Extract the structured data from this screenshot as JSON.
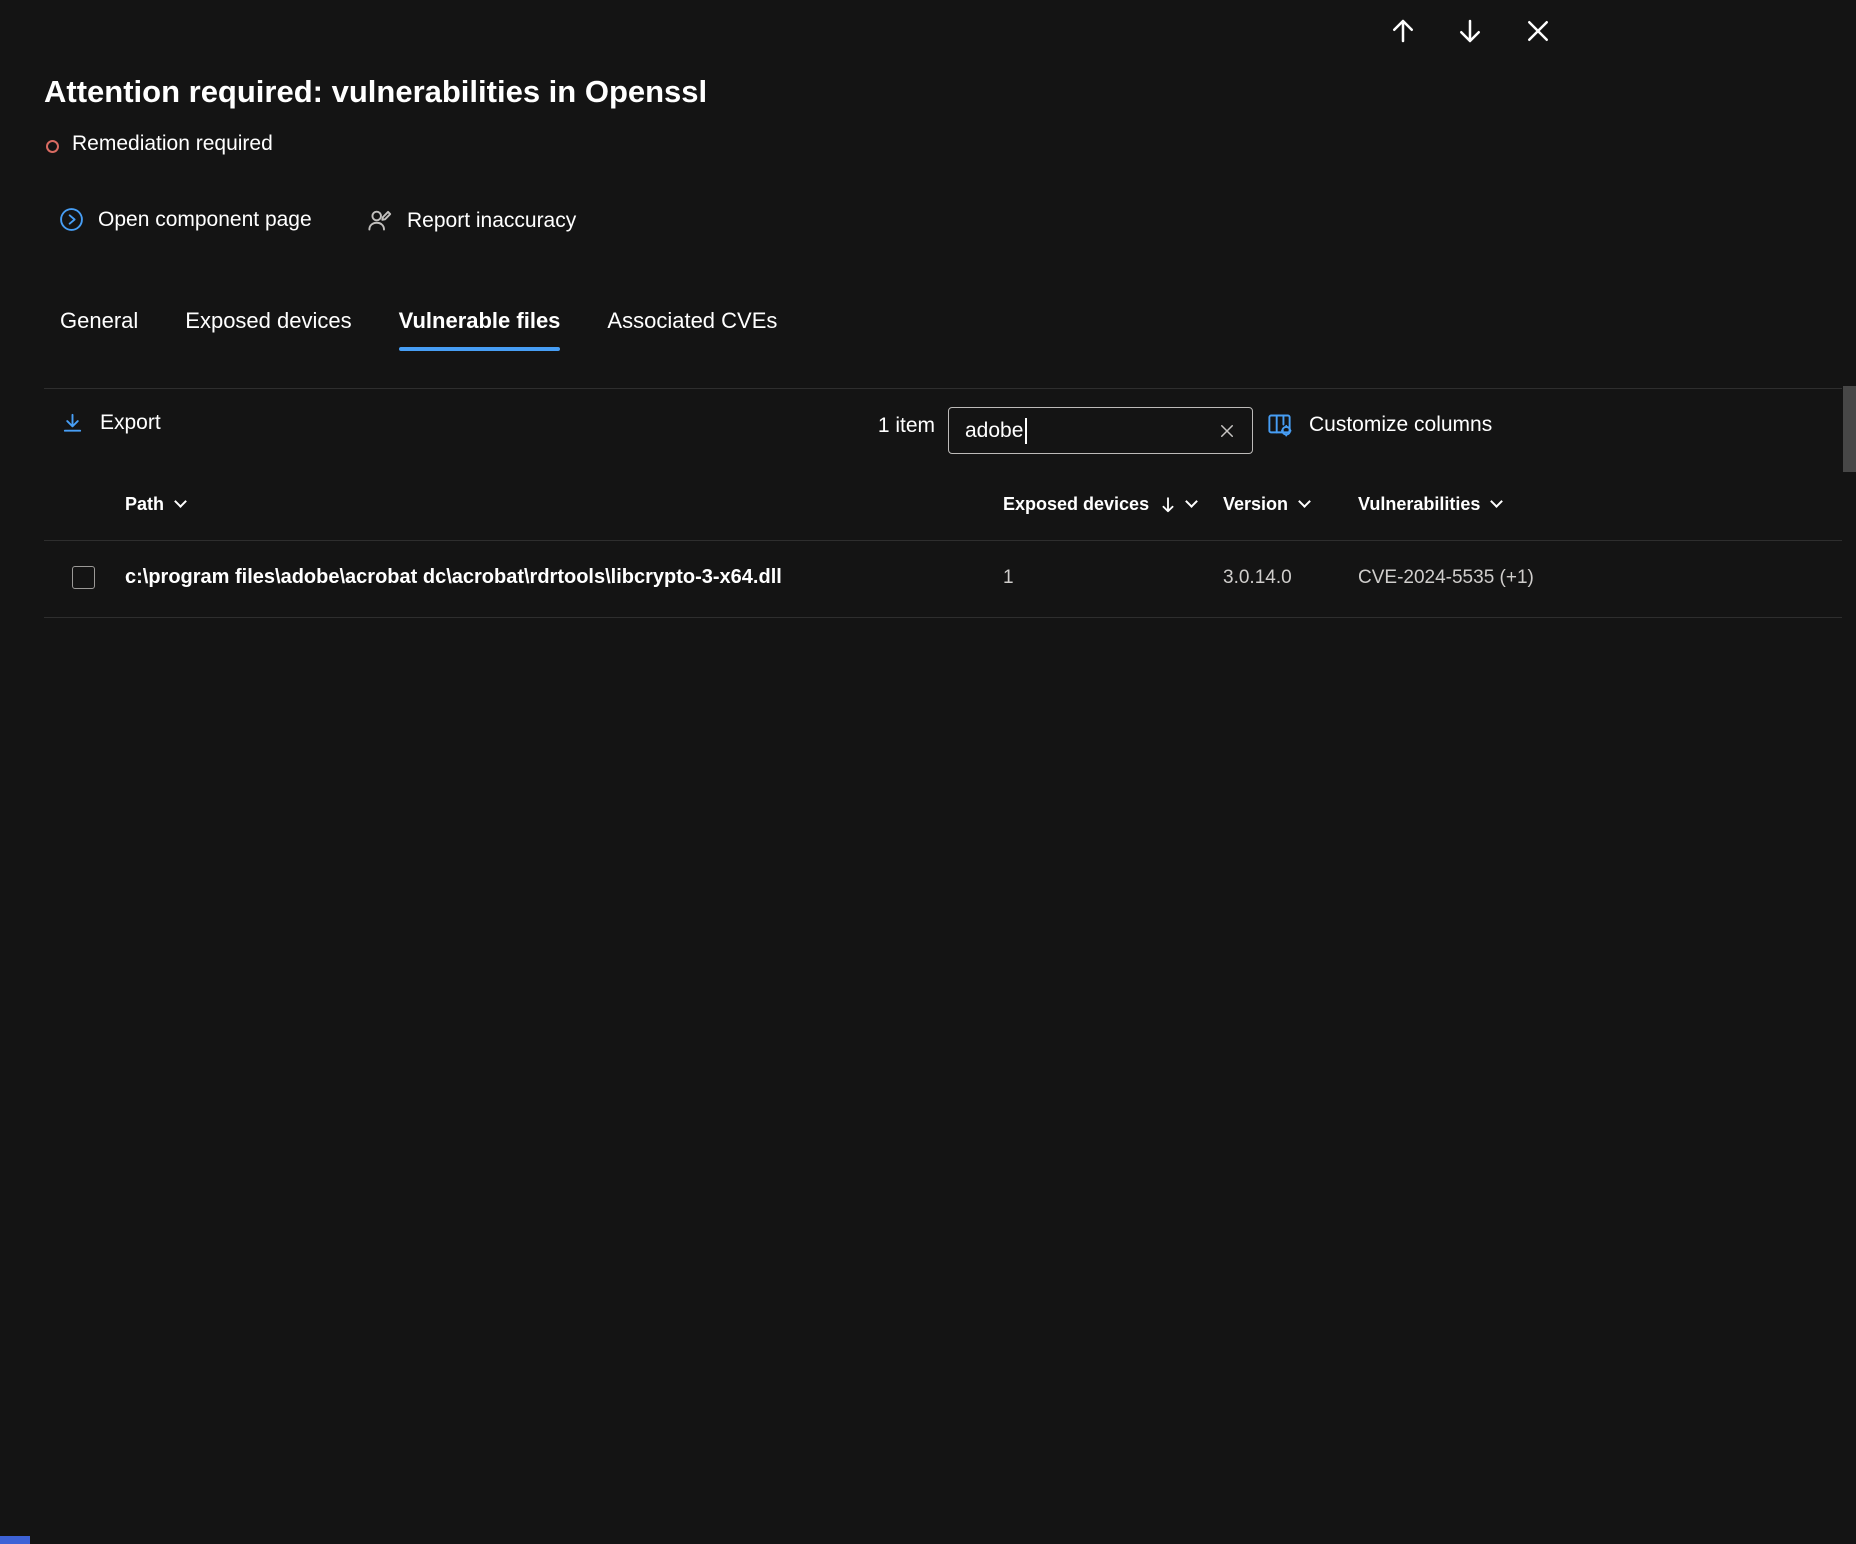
{
  "header": {
    "title": "Attention required: vulnerabilities in Openssl",
    "status": "Remediation required"
  },
  "actions": {
    "open_component": "Open component page",
    "report_inaccuracy": "Report inaccuracy"
  },
  "tabs": [
    {
      "label": "General",
      "active": false
    },
    {
      "label": "Exposed devices",
      "active": false
    },
    {
      "label": "Vulnerable files",
      "active": true
    },
    {
      "label": "Associated CVEs",
      "active": false
    }
  ],
  "toolbar": {
    "export_label": "Export",
    "item_count": "1 item",
    "search_value": "adobe",
    "customize_label": "Customize columns"
  },
  "table": {
    "columns": [
      "Path",
      "Exposed devices",
      "Version",
      "Vulnerabilities"
    ],
    "sorted_column": "Exposed devices",
    "sort_direction": "descending",
    "rows": [
      {
        "path": "c:\\program files\\adobe\\acrobat dc\\acrobat\\rdrtools\\libcrypto-3-x64.dll",
        "exposed_devices": "1",
        "version": "3.0.14.0",
        "vulnerabilities": "CVE-2024-5535 (+1)"
      }
    ]
  },
  "icons": {
    "up_arrow": "arrow-up",
    "down_arrow": "arrow-down",
    "close": "x-cross",
    "remediation_status": "red-circle-outline",
    "open_component": "circle-chevron-right",
    "report_inaccuracy": "person-feedback",
    "export": "download-arrow",
    "search_clear": "x-cross",
    "customize_columns": "table-columns-gear",
    "column_menu": "chevron-down",
    "sort": "arrow-down"
  },
  "colors": {
    "background": "#141414",
    "accent": "#479ef5",
    "status_red": "#d96b62",
    "divider": "#2e2e2e",
    "secondary_text": "#d0cecc"
  }
}
